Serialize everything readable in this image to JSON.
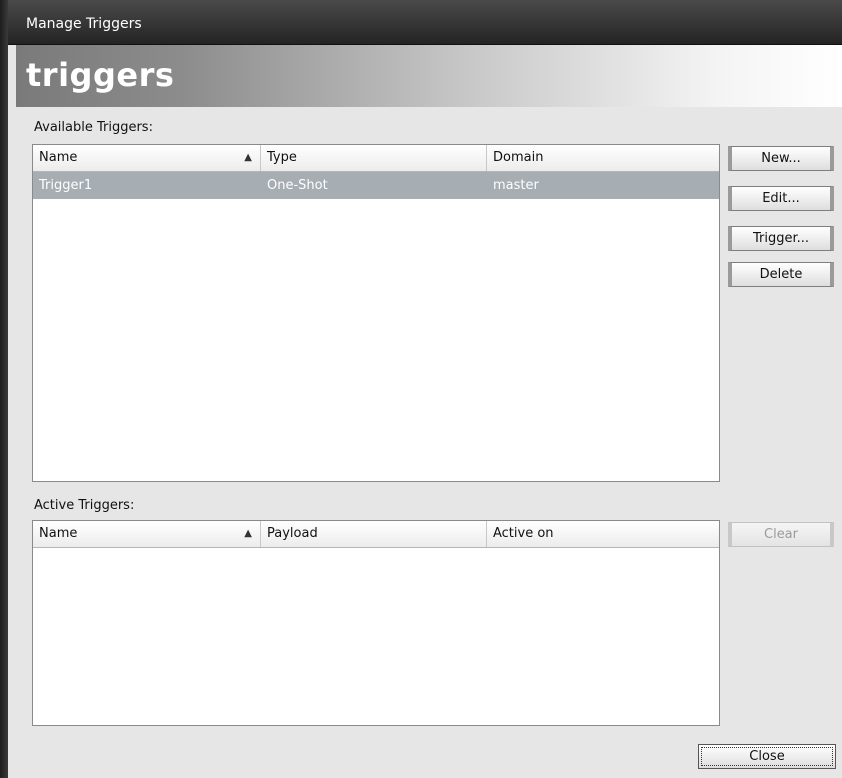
{
  "window": {
    "title": "Manage Triggers"
  },
  "banner": {
    "title": "triggers"
  },
  "available": {
    "label": "Available Triggers:",
    "columns": [
      "Name",
      "Type",
      "Domain"
    ],
    "sort_icon": "▲",
    "rows": [
      {
        "name": "Trigger1",
        "type": "One-Shot",
        "domain": "master",
        "selected": true
      }
    ],
    "buttons": {
      "new": "New...",
      "edit": "Edit...",
      "trigger": "Trigger...",
      "delete": "Delete"
    }
  },
  "active": {
    "label": "Active Triggers:",
    "columns": [
      "Name",
      "Payload",
      "Active on"
    ],
    "sort_icon": "▲",
    "rows": [],
    "buttons": {
      "clear": "Clear"
    }
  },
  "footer": {
    "close": "Close"
  },
  "colors": {
    "selection": "#a6adb3",
    "titlebar": "#2e2e2e"
  }
}
